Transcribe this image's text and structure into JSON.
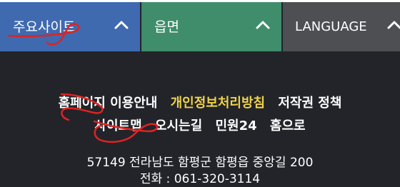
{
  "tabs": [
    {
      "label": "주요사이트",
      "color": "#3f6ab0"
    },
    {
      "label": "읍면",
      "color": "#3f8d6b"
    },
    {
      "label": "LANGUAGE",
      "color": "#4e4f53"
    }
  ],
  "footer_links": {
    "row1": [
      "홈페이지 이용안내",
      "개인정보처리방침",
      "저작권 정책"
    ],
    "row2": [
      "사이트맵",
      "오시는길",
      "민원24",
      "홈으로"
    ]
  },
  "address": "57149 전라남도 함평군 함평읍 중앙길 200",
  "phone": "전화 : 061-320-3114",
  "colors": {
    "background": "#222429",
    "highlight": "#f0d24a",
    "annotation": "#e02222"
  }
}
